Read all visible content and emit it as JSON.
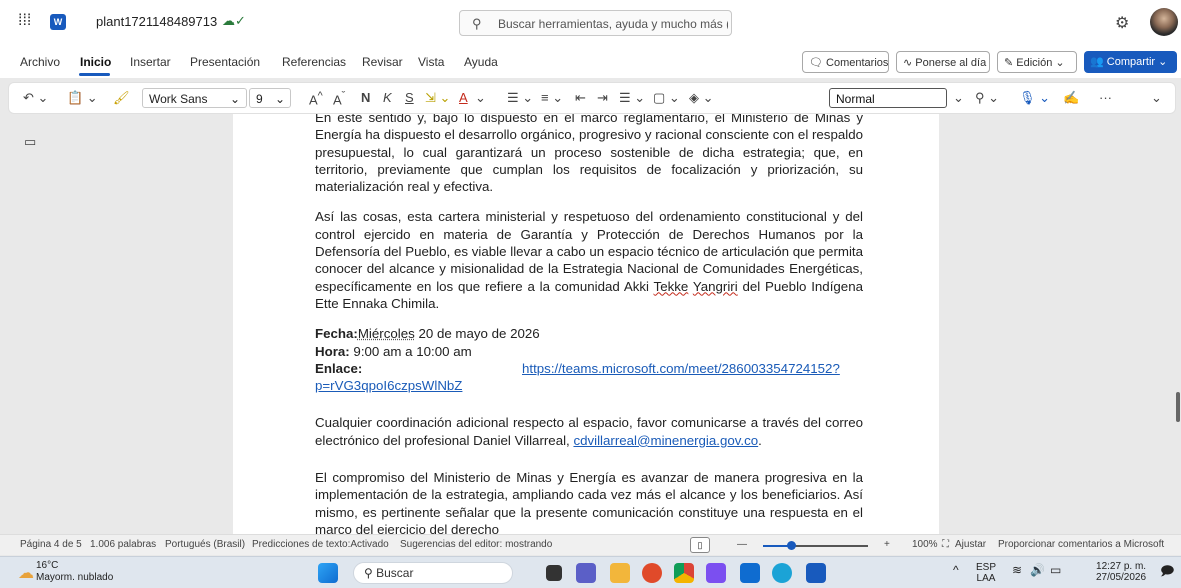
{
  "titlebar": {
    "doc_title": "plant1721148489713",
    "search_placeholder": "Buscar herramientas, ayuda y mucho más (Alt + Q)"
  },
  "menu": {
    "items": [
      "Archivo",
      "Inicio",
      "Insertar",
      "Presentación",
      "Referencias",
      "Revisar",
      "Vista",
      "Ayuda"
    ],
    "comments_label": "Comentarios",
    "catchup_label": "Ponerse al día",
    "editing_label": "Edición",
    "share_label": "Compartir"
  },
  "toolbar": {
    "font": "Work Sans",
    "size": "9",
    "style": "Normal",
    "bold": "N",
    "italic": "K",
    "underline": "S"
  },
  "document": {
    "p1": "En este sentido y, bajo lo dispuesto en el marco reglamentario, el Ministerio de Minas y Energía ha dispuesto el desarrollo orgánico, progresivo y racional consciente con el respaldo presupuestal, lo cual garantizará un proceso sostenible de dicha estrategia; que, en territorio, previamente que cumplan los requisitos de focalización y priorización, su materialización real y efectiva.",
    "p2_a": "Así las cosas, esta cartera ministerial y respetuoso del ordenamiento constitucional y del control ejercido en materia de Garantía y Protección de Derechos Humanos por la Defensoría del Pueblo, es viable llevar a cabo un espacio técnico de articulación que permita conocer del alcance y misionalidad de la Estrategia Nacional de Comunidades Energéticas, específicamente en los que refiere a la comunidad Akki ",
    "p2_tekke": "Tekke",
    "p2_sp": " ",
    "p2_yangriri": "Yangriri",
    "p2_b": " del Pueblo Indígena Ette Ennaka Chimila.",
    "fecha_label": "Fecha:",
    "fecha_day": "Miércoles",
    "fecha_value": " 20 de mayo de 2026",
    "hora_label": "Hora:",
    "hora_value": " 9:00 am a 10:00 am",
    "enlace_label": "Enlace:",
    "enlace_url1": "https://teams.microsoft.com/meet/286003354724152?",
    "enlace_url2": "p=rVG3qpoI6czpsWlNbZ",
    "p3_a": "Cualquier coordinación adicional respecto al espacio, favor comunicarse a través del correo electrónico del profesional Daniel Villarreal, ",
    "p3_email": "cdvillarreal@minenergia.gov.co",
    "p3_b": ".",
    "p4": "El compromiso del Ministerio de Minas y Energía es avanzar de manera progresiva en la implementación de la estrategia, ampliando cada vez más el alcance y los beneficiarios. Así mismo, es pertinente señalar que la presente comunicación constituye una respuesta en el marco del ejercicio del derecho"
  },
  "status": {
    "page": "Página 4 de 5",
    "words": "1.006 palabras",
    "language": "Portugués (Brasil)",
    "predictions": "Predicciones de texto:Activado",
    "suggestions": "Sugerencias del editor: mostrando",
    "zoom": "100%",
    "fit": "Ajustar",
    "feedback": "Proporcionar comentarios a Microsoft"
  },
  "taskbar": {
    "temp": "16°C",
    "weather": "Mayorm. nublado",
    "search": "Buscar",
    "lang1": "ESP",
    "lang2": "LAA",
    "time": "12:27 p. m.",
    "date": "27/05/2026"
  }
}
